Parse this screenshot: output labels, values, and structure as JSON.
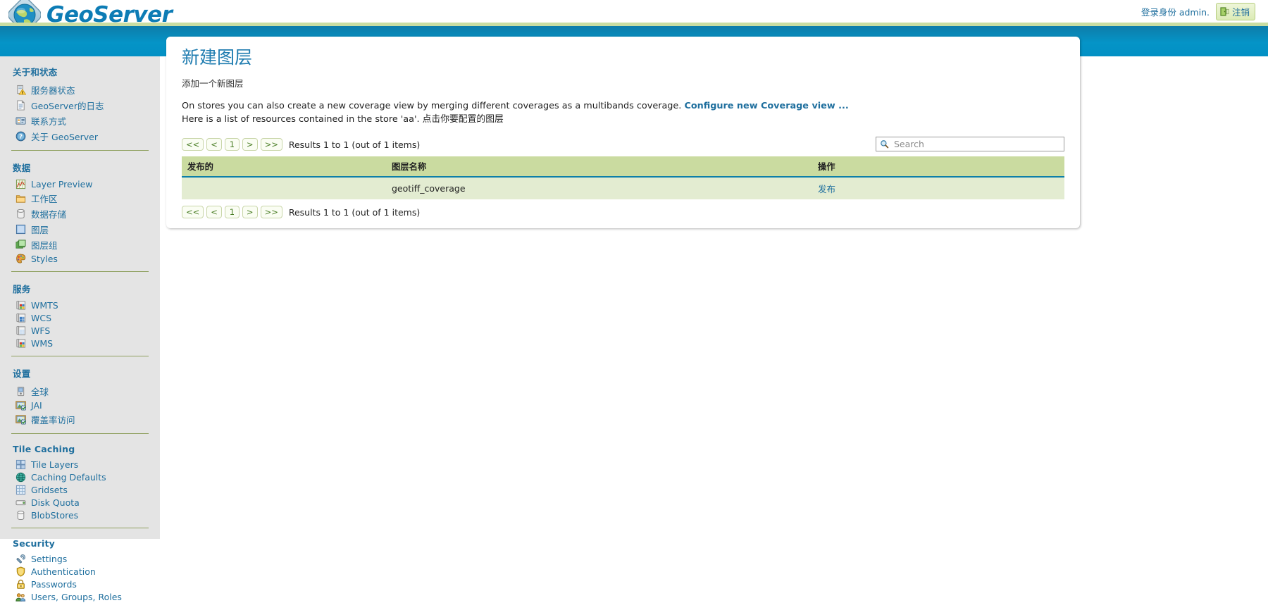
{
  "header": {
    "logo_text": "GeoServer",
    "logo_icon": "globe-icon",
    "login_text": "登录身份 admin.",
    "logout_label": "注销",
    "logout_icon": "door-exit-icon"
  },
  "sidebar": {
    "groups": [
      {
        "title": "关于和状态",
        "items": [
          {
            "label": "服务器状态",
            "icon": "server-status-icon"
          },
          {
            "label": "GeoServer的日志",
            "icon": "document-log-icon"
          },
          {
            "label": "联系方式",
            "icon": "contact-card-icon"
          },
          {
            "label": "关于 GeoServer",
            "icon": "help-question-icon"
          }
        ]
      },
      {
        "title": "数据",
        "items": [
          {
            "label": "Layer Preview",
            "icon": "layer-preview-icon"
          },
          {
            "label": "工作区",
            "icon": "folder-icon"
          },
          {
            "label": "数据存储",
            "icon": "database-icon"
          },
          {
            "label": "图层",
            "icon": "layer-icon"
          },
          {
            "label": "图层组",
            "icon": "layer-group-icon"
          },
          {
            "label": "Styles",
            "icon": "palette-icon"
          }
        ]
      },
      {
        "title": "服务",
        "items": [
          {
            "label": "WMTS",
            "icon": "service-wmts-icon"
          },
          {
            "label": "WCS",
            "icon": "service-wcs-icon"
          },
          {
            "label": "WFS",
            "icon": "service-wfs-icon"
          },
          {
            "label": "WMS",
            "icon": "service-wms-icon"
          }
        ]
      },
      {
        "title": "设置",
        "items": [
          {
            "label": "全球",
            "icon": "global-settings-icon"
          },
          {
            "label": "JAI",
            "icon": "jai-image-icon"
          },
          {
            "label": "覆盖率访问",
            "icon": "coverage-access-icon"
          }
        ]
      },
      {
        "title": "Tile Caching",
        "items": [
          {
            "label": "Tile Layers",
            "icon": "tile-layers-icon"
          },
          {
            "label": "Caching Defaults",
            "icon": "globe-cache-icon"
          },
          {
            "label": "Gridsets",
            "icon": "gridset-icon"
          },
          {
            "label": "Disk Quota",
            "icon": "disk-quota-icon"
          },
          {
            "label": "BlobStores",
            "icon": "blobstore-icon"
          }
        ]
      },
      {
        "title": "Security",
        "items": [
          {
            "label": "Settings",
            "icon": "wrench-icon"
          },
          {
            "label": "Authentication",
            "icon": "shield-icon"
          },
          {
            "label": "Passwords",
            "icon": "lock-icon"
          },
          {
            "label": "Users, Groups, Roles",
            "icon": "users-icon"
          }
        ]
      }
    ]
  },
  "main": {
    "title": "新建图层",
    "subtitle": "添加一个新图层",
    "info_line_1_prefix": "On stores you can also create a new coverage view by merging different coverages as a multibands coverage. ",
    "coverage_view_link": "Configure new Coverage view ...",
    "info_line_2": "Here is a list of resources contained in the store 'aa'. 点击你要配置的图层",
    "pager": {
      "first": "<<",
      "prev": "<",
      "page": "1",
      "next": ">",
      "last": ">>",
      "results_label": "Results 1 to 1 (out of 1 items)"
    },
    "search": {
      "placeholder": "Search",
      "value": "",
      "icon": "search-icon"
    },
    "table": {
      "columns": [
        "发布的",
        "图层名称",
        "操作"
      ],
      "rows": [
        {
          "published": "",
          "layer_name": "geotiff_coverage",
          "action": "发布"
        }
      ]
    }
  },
  "colors": {
    "brand_blue": "#0594c7",
    "header_blue": "#1f7cb0",
    "link_blue": "#1f6f9e",
    "green_stripe": "#c9dda2",
    "table_header_green": "#cadba0",
    "table_row_green": "#e3ecd1",
    "sidebar_gray": "#e4e4e4"
  }
}
